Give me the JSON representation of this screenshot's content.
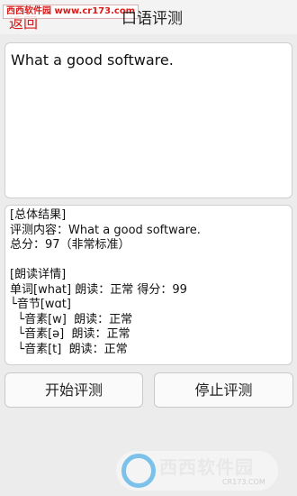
{
  "watermark": "西西软件园 www.cr173.com",
  "header": {
    "back_label": "返回",
    "title": "口语评测"
  },
  "input": {
    "text": "What a good software.",
    "speaker_icon": "speaker-icon"
  },
  "result": {
    "lines": [
      "[总体结果]",
      "评测内容：What a good software.",
      "总分：97（非常标准）",
      "",
      "[朗读详情]",
      "单词[what] 朗读：正常 得分：99",
      "└音节[wɑt]",
      "  └音素[w]  朗读：正常",
      "  └音素[ə]  朗读：正常",
      "  └音素[t]  朗读：正常"
    ]
  },
  "buttons": {
    "start": "开始评测",
    "stop": "停止评测"
  },
  "logo": {
    "main": "西西软件园",
    "sub": "CR173.COM"
  },
  "colors": {
    "accent_red": "#d81c1c",
    "background": "#ececec"
  }
}
